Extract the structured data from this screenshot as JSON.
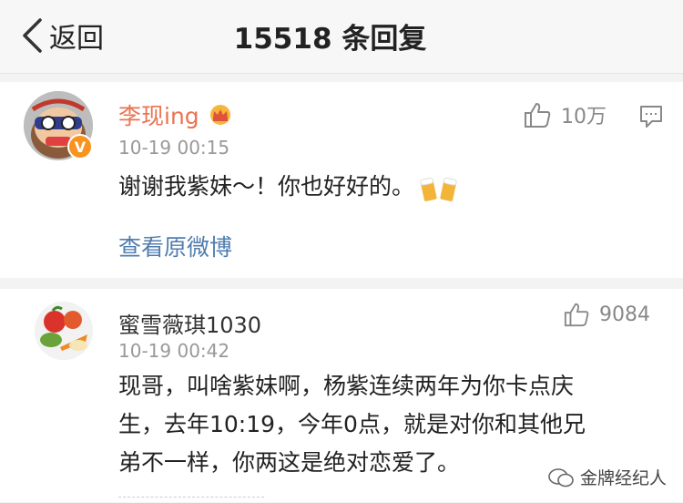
{
  "header": {
    "back_label": "返回",
    "title": "15518 条回复"
  },
  "comments": [
    {
      "username": "李现ing",
      "verified_badge": "V",
      "time": "10-19 00:15",
      "content": "谢谢我紫妹～！你也好好的。",
      "likes": "10万",
      "view_original": "查看原微博"
    },
    {
      "username": "蜜雪薇琪1030",
      "time": "10-19 00:42",
      "content_lines": [
        "现哥，叫啥紫妹啊，杨紫连续两年为你卡点庆",
        "生，去年10:19，今年0点，就是对你和其他兄",
        "弟不一样，你两这是绝对恋爱了。"
      ],
      "likes": "9084"
    }
  ],
  "watermark": "金牌经纪人",
  "colors": {
    "primary_name": "#eb7350",
    "link": "#507daf",
    "verified": "#f7931e",
    "muted": "#999999"
  }
}
